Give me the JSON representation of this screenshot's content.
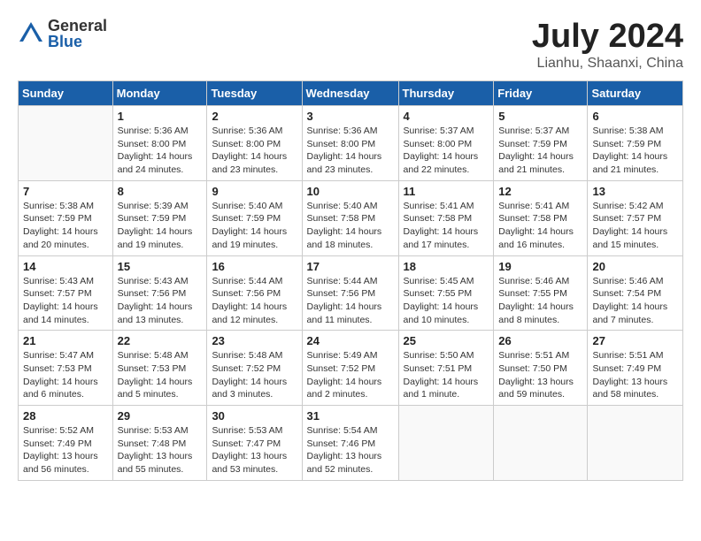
{
  "header": {
    "logo_general": "General",
    "logo_blue": "Blue",
    "month_year": "July 2024",
    "location": "Lianhu, Shaanxi, China"
  },
  "days_of_week": [
    "Sunday",
    "Monday",
    "Tuesday",
    "Wednesday",
    "Thursday",
    "Friday",
    "Saturday"
  ],
  "weeks": [
    [
      {
        "day": "",
        "info": ""
      },
      {
        "day": "1",
        "info": "Sunrise: 5:36 AM\nSunset: 8:00 PM\nDaylight: 14 hours\nand 24 minutes."
      },
      {
        "day": "2",
        "info": "Sunrise: 5:36 AM\nSunset: 8:00 PM\nDaylight: 14 hours\nand 23 minutes."
      },
      {
        "day": "3",
        "info": "Sunrise: 5:36 AM\nSunset: 8:00 PM\nDaylight: 14 hours\nand 23 minutes."
      },
      {
        "day": "4",
        "info": "Sunrise: 5:37 AM\nSunset: 8:00 PM\nDaylight: 14 hours\nand 22 minutes."
      },
      {
        "day": "5",
        "info": "Sunrise: 5:37 AM\nSunset: 7:59 PM\nDaylight: 14 hours\nand 21 minutes."
      },
      {
        "day": "6",
        "info": "Sunrise: 5:38 AM\nSunset: 7:59 PM\nDaylight: 14 hours\nand 21 minutes."
      }
    ],
    [
      {
        "day": "7",
        "info": "Sunrise: 5:38 AM\nSunset: 7:59 PM\nDaylight: 14 hours\nand 20 minutes."
      },
      {
        "day": "8",
        "info": "Sunrise: 5:39 AM\nSunset: 7:59 PM\nDaylight: 14 hours\nand 19 minutes."
      },
      {
        "day": "9",
        "info": "Sunrise: 5:40 AM\nSunset: 7:59 PM\nDaylight: 14 hours\nand 19 minutes."
      },
      {
        "day": "10",
        "info": "Sunrise: 5:40 AM\nSunset: 7:58 PM\nDaylight: 14 hours\nand 18 minutes."
      },
      {
        "day": "11",
        "info": "Sunrise: 5:41 AM\nSunset: 7:58 PM\nDaylight: 14 hours\nand 17 minutes."
      },
      {
        "day": "12",
        "info": "Sunrise: 5:41 AM\nSunset: 7:58 PM\nDaylight: 14 hours\nand 16 minutes."
      },
      {
        "day": "13",
        "info": "Sunrise: 5:42 AM\nSunset: 7:57 PM\nDaylight: 14 hours\nand 15 minutes."
      }
    ],
    [
      {
        "day": "14",
        "info": "Sunrise: 5:43 AM\nSunset: 7:57 PM\nDaylight: 14 hours\nand 14 minutes."
      },
      {
        "day": "15",
        "info": "Sunrise: 5:43 AM\nSunset: 7:56 PM\nDaylight: 14 hours\nand 13 minutes."
      },
      {
        "day": "16",
        "info": "Sunrise: 5:44 AM\nSunset: 7:56 PM\nDaylight: 14 hours\nand 12 minutes."
      },
      {
        "day": "17",
        "info": "Sunrise: 5:44 AM\nSunset: 7:56 PM\nDaylight: 14 hours\nand 11 minutes."
      },
      {
        "day": "18",
        "info": "Sunrise: 5:45 AM\nSunset: 7:55 PM\nDaylight: 14 hours\nand 10 minutes."
      },
      {
        "day": "19",
        "info": "Sunrise: 5:46 AM\nSunset: 7:55 PM\nDaylight: 14 hours\nand 8 minutes."
      },
      {
        "day": "20",
        "info": "Sunrise: 5:46 AM\nSunset: 7:54 PM\nDaylight: 14 hours\nand 7 minutes."
      }
    ],
    [
      {
        "day": "21",
        "info": "Sunrise: 5:47 AM\nSunset: 7:53 PM\nDaylight: 14 hours\nand 6 minutes."
      },
      {
        "day": "22",
        "info": "Sunrise: 5:48 AM\nSunset: 7:53 PM\nDaylight: 14 hours\nand 5 minutes."
      },
      {
        "day": "23",
        "info": "Sunrise: 5:48 AM\nSunset: 7:52 PM\nDaylight: 14 hours\nand 3 minutes."
      },
      {
        "day": "24",
        "info": "Sunrise: 5:49 AM\nSunset: 7:52 PM\nDaylight: 14 hours\nand 2 minutes."
      },
      {
        "day": "25",
        "info": "Sunrise: 5:50 AM\nSunset: 7:51 PM\nDaylight: 14 hours\nand 1 minute."
      },
      {
        "day": "26",
        "info": "Sunrise: 5:51 AM\nSunset: 7:50 PM\nDaylight: 13 hours\nand 59 minutes."
      },
      {
        "day": "27",
        "info": "Sunrise: 5:51 AM\nSunset: 7:49 PM\nDaylight: 13 hours\nand 58 minutes."
      }
    ],
    [
      {
        "day": "28",
        "info": "Sunrise: 5:52 AM\nSunset: 7:49 PM\nDaylight: 13 hours\nand 56 minutes."
      },
      {
        "day": "29",
        "info": "Sunrise: 5:53 AM\nSunset: 7:48 PM\nDaylight: 13 hours\nand 55 minutes."
      },
      {
        "day": "30",
        "info": "Sunrise: 5:53 AM\nSunset: 7:47 PM\nDaylight: 13 hours\nand 53 minutes."
      },
      {
        "day": "31",
        "info": "Sunrise: 5:54 AM\nSunset: 7:46 PM\nDaylight: 13 hours\nand 52 minutes."
      },
      {
        "day": "",
        "info": ""
      },
      {
        "day": "",
        "info": ""
      },
      {
        "day": "",
        "info": ""
      }
    ]
  ]
}
